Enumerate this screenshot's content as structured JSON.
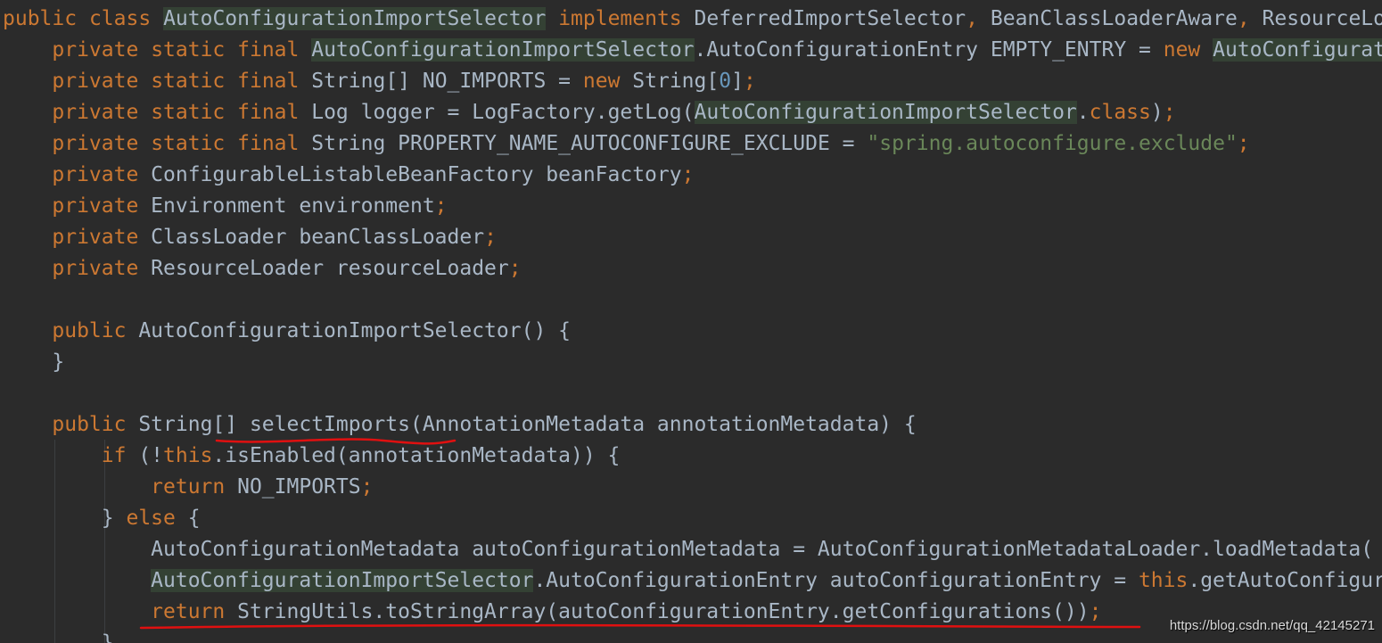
{
  "code_lines": [
    {
      "indent": "",
      "tokens": [
        {
          "t": "public",
          "c": "kw"
        },
        {
          "t": " "
        },
        {
          "t": "class",
          "c": "kw"
        },
        {
          "t": " "
        },
        {
          "t": "AutoConfigurationImportSelector",
          "hl": true
        },
        {
          "t": " "
        },
        {
          "t": "implements",
          "c": "kw"
        },
        {
          "t": " DeferredImportSelector"
        },
        {
          "t": ",",
          "c": "kw"
        },
        {
          "t": " BeanClassLoaderAware"
        },
        {
          "t": ",",
          "c": "kw"
        },
        {
          "t": " ResourceLoaderAware"
        }
      ]
    },
    {
      "indent": "    ",
      "tokens": [
        {
          "t": "private",
          "c": "kw"
        },
        {
          "t": " "
        },
        {
          "t": "static",
          "c": "kw"
        },
        {
          "t": " "
        },
        {
          "t": "final",
          "c": "kw"
        },
        {
          "t": " "
        },
        {
          "t": "AutoConfigurationImportSelector",
          "hl": true
        },
        {
          "t": ".AutoConfigurationEntry EMPTY_ENTRY = "
        },
        {
          "t": "new",
          "c": "kw"
        },
        {
          "t": " "
        },
        {
          "t": "AutoConfigurationImportSelector",
          "hl": true
        }
      ]
    },
    {
      "indent": "    ",
      "tokens": [
        {
          "t": "private",
          "c": "kw"
        },
        {
          "t": " "
        },
        {
          "t": "static",
          "c": "kw"
        },
        {
          "t": " "
        },
        {
          "t": "final",
          "c": "kw"
        },
        {
          "t": " String[] NO_IMPORTS = "
        },
        {
          "t": "new",
          "c": "kw"
        },
        {
          "t": " String["
        },
        {
          "t": "0",
          "c": "num"
        },
        {
          "t": "]"
        },
        {
          "t": ";",
          "c": "kw"
        }
      ]
    },
    {
      "indent": "    ",
      "tokens": [
        {
          "t": "private",
          "c": "kw"
        },
        {
          "t": " "
        },
        {
          "t": "static",
          "c": "kw"
        },
        {
          "t": " "
        },
        {
          "t": "final",
          "c": "kw"
        },
        {
          "t": " Log logger = LogFactory.getLog("
        },
        {
          "t": "AutoConfigurationImportSelector",
          "hl": true
        },
        {
          "t": "."
        },
        {
          "t": "class",
          "c": "kw"
        },
        {
          "t": ")"
        },
        {
          "t": ";",
          "c": "kw"
        }
      ]
    },
    {
      "indent": "    ",
      "tokens": [
        {
          "t": "private",
          "c": "kw"
        },
        {
          "t": " "
        },
        {
          "t": "static",
          "c": "kw"
        },
        {
          "t": " "
        },
        {
          "t": "final",
          "c": "kw"
        },
        {
          "t": " String PROPERTY_NAME_AUTOCONFIGURE_EXCLUDE = "
        },
        {
          "t": "\"spring.autoconfigure.exclude\"",
          "c": "str"
        },
        {
          "t": ";",
          "c": "kw"
        }
      ]
    },
    {
      "indent": "    ",
      "tokens": [
        {
          "t": "private",
          "c": "kw"
        },
        {
          "t": " ConfigurableListableBeanFactory beanFactory"
        },
        {
          "t": ";",
          "c": "kw"
        }
      ]
    },
    {
      "indent": "    ",
      "tokens": [
        {
          "t": "private",
          "c": "kw"
        },
        {
          "t": " Environment environment"
        },
        {
          "t": ";",
          "c": "kw"
        }
      ]
    },
    {
      "indent": "    ",
      "tokens": [
        {
          "t": "private",
          "c": "kw"
        },
        {
          "t": " ClassLoader beanClassLoader"
        },
        {
          "t": ";",
          "c": "kw"
        }
      ]
    },
    {
      "indent": "    ",
      "tokens": [
        {
          "t": "private",
          "c": "kw"
        },
        {
          "t": " ResourceLoader resourceLoader"
        },
        {
          "t": ";",
          "c": "kw"
        }
      ]
    },
    {
      "indent": "",
      "tokens": []
    },
    {
      "indent": "    ",
      "tokens": [
        {
          "t": "public",
          "c": "kw"
        },
        {
          "t": " AutoConfigurationImportSelector() {"
        }
      ]
    },
    {
      "indent": "    ",
      "tokens": [
        {
          "t": "}"
        }
      ]
    },
    {
      "indent": "",
      "tokens": []
    },
    {
      "indent": "    ",
      "tokens": [
        {
          "t": "public",
          "c": "kw"
        },
        {
          "t": " String[] selectImports(AnnotationMetadata annotationMetadata) {"
        }
      ]
    },
    {
      "indent": "        ",
      "tokens": [
        {
          "t": "if",
          "c": "kw"
        },
        {
          "t": " (!"
        },
        {
          "t": "this",
          "c": "kw"
        },
        {
          "t": ".isEnabled(annotationMetadata)) {"
        }
      ]
    },
    {
      "indent": "            ",
      "tokens": [
        {
          "t": "return",
          "c": "kw"
        },
        {
          "t": " NO_IMPORTS"
        },
        {
          "t": ";",
          "c": "kw"
        }
      ]
    },
    {
      "indent": "        ",
      "tokens": [
        {
          "t": "} "
        },
        {
          "t": "else",
          "c": "kw"
        },
        {
          "t": " {"
        }
      ]
    },
    {
      "indent": "            ",
      "tokens": [
        {
          "t": "AutoConfigurationMetadata autoConfigurationMetadata = AutoConfigurationMetadataLoader.loadMetadata("
        }
      ]
    },
    {
      "indent": "            ",
      "tokens": [
        {
          "t": "AutoConfigurationImportSelector",
          "hl": true
        },
        {
          "t": ".AutoConfigurationEntry autoConfigurationEntry = "
        },
        {
          "t": "this",
          "c": "kw"
        },
        {
          "t": ".getAutoConfigurationEntry("
        }
      ]
    },
    {
      "indent": "            ",
      "tokens": [
        {
          "t": "return",
          "c": "kw"
        },
        {
          "t": " StringUtils.toStringArray(autoConfigurationEntry.getConfigurations())"
        },
        {
          "t": ";",
          "c": "kw"
        }
      ]
    },
    {
      "indent": "        ",
      "tokens": [
        {
          "t": "}"
        }
      ]
    }
  ],
  "watermark": "https://blog.csdn.net/qq_42145271",
  "colors": {
    "background": "#2b2b2b",
    "keyword": "#cc7832",
    "string": "#6a8759",
    "number": "#6897bb",
    "plain": "#a9b7c6",
    "highlight": "#344134",
    "annotation_underline": "#e01010"
  }
}
